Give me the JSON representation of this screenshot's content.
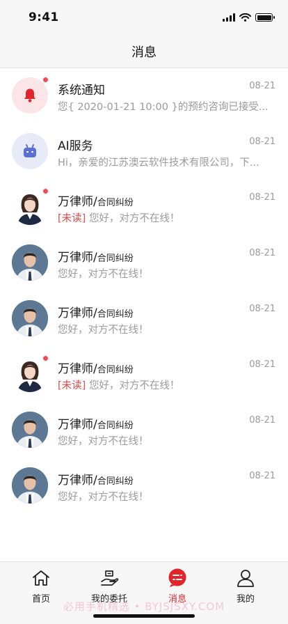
{
  "status_bar": {
    "time": "9:41"
  },
  "header": {
    "title": "消息"
  },
  "messages": [
    {
      "avatar": "bell-icon",
      "title": "系统通知",
      "subtitle": "",
      "date": "08-21",
      "unread_tag": "",
      "preview": "您{ 2020-01-21 10:00 }的预约咨询已接受...",
      "has_dot": true
    },
    {
      "avatar": "robot-icon",
      "title": "AI服务",
      "subtitle": "",
      "date": "08-21",
      "unread_tag": "",
      "preview": "Hi，亲爱的江苏澳云软件技术有限公司，下...",
      "has_dot": false
    },
    {
      "avatar": "woman-lawyer",
      "title": "万律师/",
      "subtitle": "合同纠纷",
      "date": "08-21",
      "unread_tag": "[未读]",
      "preview": "您好，对方不在线！",
      "has_dot": true
    },
    {
      "avatar": "man-lawyer",
      "title": "万律师/",
      "subtitle": "合同纠纷",
      "date": "08-21",
      "unread_tag": "",
      "preview": "您好，对方不在线！",
      "has_dot": false
    },
    {
      "avatar": "man-lawyer",
      "title": "万律师/",
      "subtitle": "合同纠纷",
      "date": "08-21",
      "unread_tag": "",
      "preview": "您好，对方不在线！",
      "has_dot": false
    },
    {
      "avatar": "woman-lawyer",
      "title": "万律师/",
      "subtitle": "合同纠纷",
      "date": "08-21",
      "unread_tag": "[未读]",
      "preview": "您好，对方不在线！",
      "has_dot": true
    },
    {
      "avatar": "man-lawyer",
      "title": "万律师/",
      "subtitle": "合同纠纷",
      "date": "08-21",
      "unread_tag": "",
      "preview": "您好，对方不在线！",
      "has_dot": false
    },
    {
      "avatar": "man-lawyer",
      "title": "万律师/",
      "subtitle": "合同纠纷",
      "date": "08-21",
      "unread_tag": "",
      "preview": "您好，对方不在线！",
      "has_dot": false
    }
  ],
  "tab_bar": {
    "items": [
      {
        "label": "首页",
        "icon": "home-icon",
        "active": false
      },
      {
        "label": "我的委托",
        "icon": "handshake-icon",
        "active": false
      },
      {
        "label": "消息",
        "icon": "message-icon",
        "active": true
      },
      {
        "label": "我的",
        "icon": "user-icon",
        "active": false
      }
    ]
  },
  "watermark": "必用手机精选 • BYJSJSXY.COM",
  "colors": {
    "accent": "#e3242b",
    "unread_dot": "#ee4d4f",
    "muted_text": "#9a9a9a"
  }
}
